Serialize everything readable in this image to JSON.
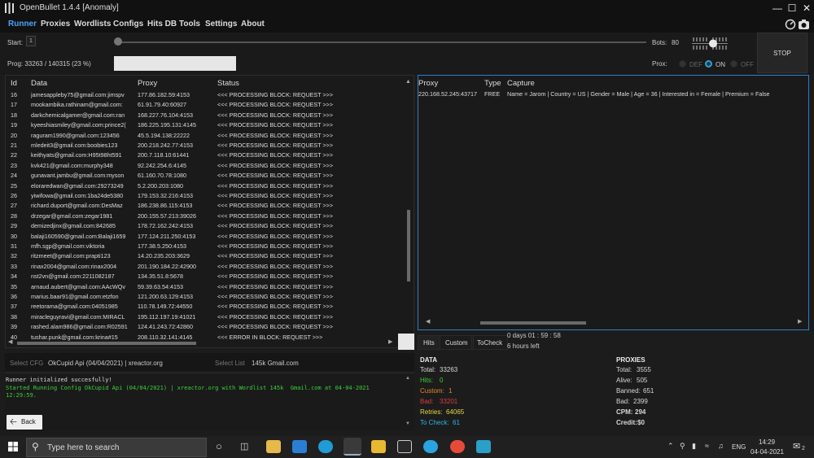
{
  "window": {
    "title": "OpenBullet 1.4.4 [Anomaly]"
  },
  "menu": [
    "Runner",
    "Proxies",
    "Wordlists",
    "Configs",
    "Hits DB",
    "Tools",
    "Settings",
    "About"
  ],
  "controls": {
    "start_label": "Start:",
    "start_value": "1",
    "bots_label": "Bots:",
    "bots_value": "80",
    "stop_label": "STOP",
    "progress_text": "Prog: 33263 / 140315 (23 %)",
    "progress_fraction": 0.237,
    "proxy_label": "Prox:",
    "proxy_options": [
      "DEF",
      "ON",
      "OFF"
    ],
    "proxy_selected": "ON"
  },
  "left_grid": {
    "headers": [
      "Id",
      "Data",
      "Proxy",
      "Status"
    ],
    "rows": [
      [
        "16",
        "jamesappleby75@gmail.com:jimspv",
        "177.86.182.59:4153",
        "<<< PROCESSING BLOCK: REQUEST >>>"
      ],
      [
        "17",
        "mookambika.rathinam@gmail.com:",
        "61.91.79.40:60927",
        "<<< PROCESSING BLOCK: REQUEST >>>"
      ],
      [
        "18",
        "darkchemicalgamer@gmail.com:ran",
        "168.227.76.104:4153",
        "<<< PROCESSING BLOCK: REQUEST >>>"
      ],
      [
        "19",
        "kyeeshiasmiley@gmail.com:prince2(",
        "186.225.195.131:4145",
        "<<< PROCESSING BLOCK: REQUEST >>>"
      ],
      [
        "20",
        "raguram1990@gmail.com:123456",
        "45.5.194.138:22222",
        "<<< PROCESSING BLOCK: REQUEST >>>"
      ],
      [
        "21",
        "mledeit3@gmail.com:boobies123",
        "200.218.242.77:4153",
        "<<< PROCESSING BLOCK: REQUEST >>>"
      ],
      [
        "22",
        "keithyats@gmail.com:H95t98ht591",
        "200.7.118.10:61441",
        "<<< PROCESSING BLOCK: REQUEST >>>"
      ],
      [
        "23",
        "kvk421@gmail.com:murphy348",
        "92.242.254.6:4145",
        "<<< PROCESSING BLOCK: REQUEST >>>"
      ],
      [
        "24",
        "gunavant.jambu@gmail.com:myson",
        "61.160.70.78:1080",
        "<<< PROCESSING BLOCK: REQUEST >>>"
      ],
      [
        "25",
        "eloraredwan@gmail.com:29273249",
        "5.2.200.203:1080",
        "<<< PROCESSING BLOCK: REQUEST >>>"
      ],
      [
        "26",
        "yiwifowa@gmail.com:1ba24de5380",
        "179.153.32.216:4153",
        "<<< PROCESSING BLOCK: REQUEST >>>"
      ],
      [
        "27",
        "richard.duport@gmail.com:DesMaz",
        "186.238.86.115:4153",
        "<<< PROCESSING BLOCK: REQUEST >>>"
      ],
      [
        "28",
        "drzegar@gmail.com:zegar1981",
        "200.155.57.213:39026",
        "<<< PROCESSING BLOCK: REQUEST >>>"
      ],
      [
        "29",
        "demizedjinx@gmail.com:842685",
        "178.72.162.242:4153",
        "<<< PROCESSING BLOCK: REQUEST >>>"
      ],
      [
        "30",
        "balaji160590@gmail.com:Balaji1659",
        "177.124.211.250:4153",
        "<<< PROCESSING BLOCK: REQUEST >>>"
      ],
      [
        "31",
        "mfh.sgp@gmail.com:viktoria",
        "177.38.5.250:4153",
        "<<< PROCESSING BLOCK: REQUEST >>>"
      ],
      [
        "32",
        "ritzmeet@gmail.com:prapti123",
        "14.20.235.203:3629",
        "<<< PROCESSING BLOCK: REQUEST >>>"
      ],
      [
        "33",
        "rinax2004@gmail.com:rinax2004",
        "201.190.184.22:42900",
        "<<< PROCESSING BLOCK: REQUEST >>>"
      ],
      [
        "34",
        "nst2vn@gmail.com:2211082187",
        "134.35.51.8:5678",
        "<<< PROCESSING BLOCK: REQUEST >>>"
      ],
      [
        "35",
        "arnaud.aubert@gmail.com:AAcWQv",
        "59.39.63.54:4153",
        "<<< PROCESSING BLOCK: REQUEST >>>"
      ],
      [
        "36",
        "marius.baar91@gmail.com:etzfon",
        "121.200.63.129:4153",
        "<<< PROCESSING BLOCK: REQUEST >>>"
      ],
      [
        "37",
        "reetorama@gmail.com:04051985",
        "110.78.149.72:44550",
        "<<< PROCESSING BLOCK: REQUEST >>>"
      ],
      [
        "38",
        "miracleguyravi@gmail.com:MIRACL",
        "195.112.197.19:41021",
        "<<< PROCESSING BLOCK: REQUEST >>>"
      ],
      [
        "39",
        "rashed.alam986@gmail.com:R02591",
        "124.41.243.72:42860",
        "<<< PROCESSING BLOCK: REQUEST >>>"
      ],
      [
        "40",
        "tushar.punk@gmail.com:krina#15",
        "208.110.32.141:4145",
        "<<< ERROR IN BLOCK: REQUEST >>>"
      ]
    ]
  },
  "right_grid": {
    "headers": [
      "Proxy",
      "Type",
      "Capture"
    ],
    "rows": [
      [
        "220.168.52.245:43717",
        "FREE",
        "Name = Jarom | Country = US | Gender = Male | Age = 36 | Interested in = Female | Premium = False"
      ]
    ]
  },
  "tabs": [
    "Hits",
    "Custom",
    "ToCheck"
  ],
  "elapsed": "0  days  01 : 59 : 58",
  "remaining": "6 hours left",
  "config": {
    "select_cfg_label": "Select CFG",
    "cfg_name": "OkCupid Api (04/04/2021) | xreactor.org",
    "select_list_label": "Select List",
    "list_name": "145k  Gmail.com"
  },
  "log": [
    {
      "text": "Runner initialized succesfully!",
      "color": "#dddddd"
    },
    {
      "text": "Started Running Config OkCupid Api (04/04/2021) | xreactor.org with Wordlist 145k  Gmail.com at 04-04-2021",
      "color": "#3ad13a"
    },
    {
      "text": "12:29:59.",
      "color": "#3ad13a"
    }
  ],
  "back_label": "Back",
  "data_stats": {
    "title": "DATA",
    "items": [
      {
        "label": "Total:",
        "value": "33263",
        "color": "#d8d8d8"
      },
      {
        "label": "Hits:",
        "value": "0",
        "color": "#3ad13a"
      },
      {
        "label": "Custom:",
        "value": "1",
        "color": "#e08a2c"
      },
      {
        "label": "Bad:",
        "value": "33201",
        "color": "#e03a3a"
      },
      {
        "label": "Retries:",
        "value": "64065",
        "color": "#e8d84a"
      },
      {
        "label": "To Check:",
        "value": "61",
        "color": "#2ab8e8"
      }
    ]
  },
  "proxy_stats": {
    "title": "PROXIES",
    "items": [
      {
        "label": "Total:",
        "value": "3555"
      },
      {
        "label": "Alive:",
        "value": "505"
      },
      {
        "label": "Banned:",
        "value": "651"
      },
      {
        "label": "Bad:",
        "value": "2399"
      },
      {
        "label": "CPM:",
        "value": "294"
      },
      {
        "label": "Credit:",
        "value": "$0"
      }
    ]
  },
  "taskbar": {
    "search_placeholder": "Type here to search",
    "language": "ENG",
    "time": "14:29",
    "date": "04-04-2021",
    "notification_count": "2"
  }
}
